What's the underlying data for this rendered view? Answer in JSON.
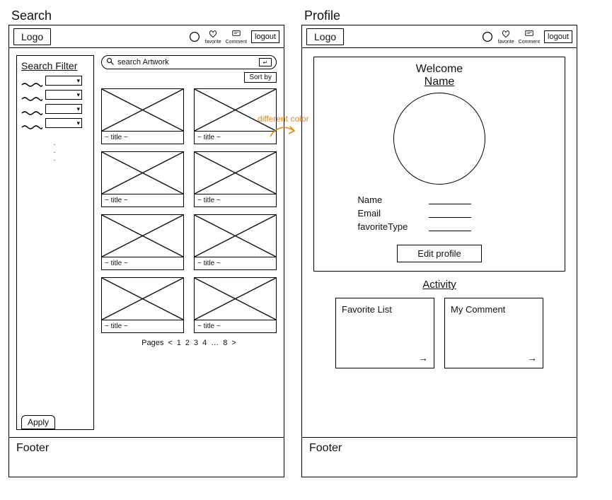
{
  "pages": {
    "search": {
      "title": "Search"
    },
    "profile": {
      "title": "Profile"
    }
  },
  "header": {
    "logo": "Logo",
    "nav": {
      "favorite": "favorite",
      "comment": "Comment"
    },
    "logout": "logout"
  },
  "search": {
    "filter": {
      "title": "Search Filter",
      "apply": "Apply"
    },
    "searchbar": {
      "placeholder": "search Artwork",
      "enter": "↵"
    },
    "sort": "Sort by",
    "card_caption": "~ title ~",
    "pagination": {
      "label": "Pages",
      "items": [
        "<",
        "1",
        "2",
        "3",
        "4",
        "…",
        "8",
        ">"
      ]
    }
  },
  "profile": {
    "welcome": "Welcome",
    "username": "Name",
    "fields": {
      "name": "Name",
      "email": "Email",
      "favtype": "favoriteType"
    },
    "edit": "Edit profile",
    "activity": {
      "title": "Activity",
      "favorite": "Favorite List",
      "comment": "My Comment"
    }
  },
  "footer": "Footer",
  "annotation": "different color"
}
